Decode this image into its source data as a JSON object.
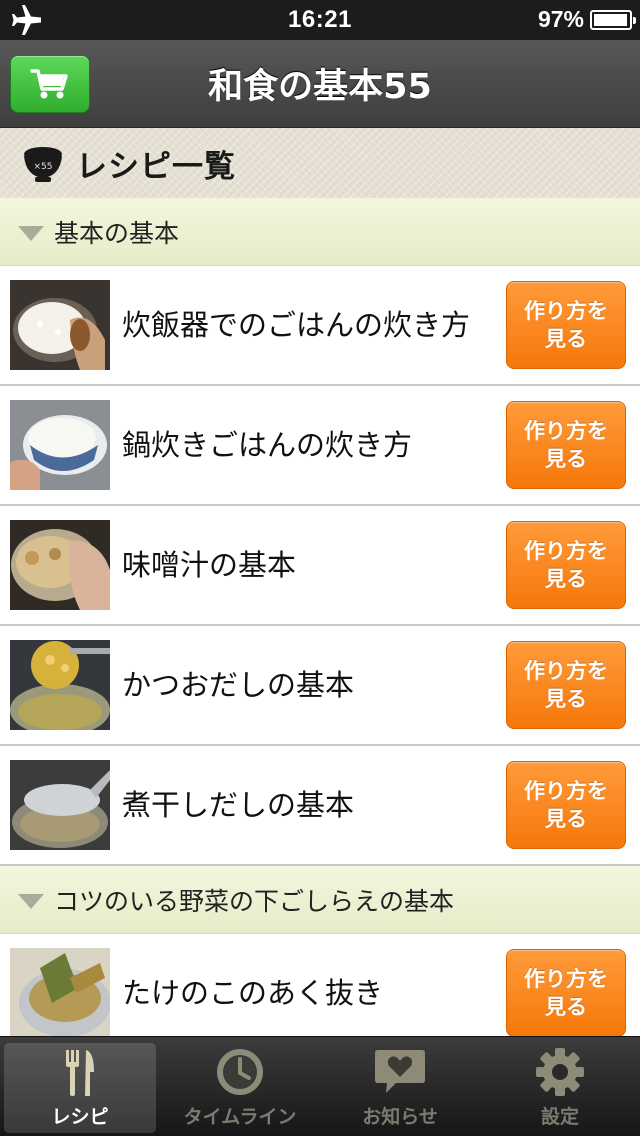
{
  "status_bar": {
    "time": "16:21",
    "battery": "97%"
  },
  "nav": {
    "title": "和食の基本55",
    "cart_icon": "cart-icon"
  },
  "section_header": {
    "title": "レシピ一覧",
    "icon": "bowl-icon"
  },
  "categories": [
    {
      "label": "基本の基本",
      "items": [
        {
          "name": "炊飯器でのごはんの炊き方",
          "button": "作り方を\n見る"
        },
        {
          "name": "鍋炊きごはんの炊き方",
          "button": "作り方を\n見る"
        },
        {
          "name": "味噌汁の基本",
          "button": "作り方を\n見る"
        },
        {
          "name": "かつおだしの基本",
          "button": "作り方を\n見る"
        },
        {
          "name": "煮干しだしの基本",
          "button": "作り方を\n見る"
        }
      ]
    },
    {
      "label": "コツのいる野菜の下ごしらえの基本",
      "items": [
        {
          "name": "たけのこのあく抜き",
          "button": "作り方を\n見る"
        }
      ]
    }
  ],
  "tabs": [
    {
      "label": "レシピ",
      "icon": "fork-knife-icon",
      "active": true
    },
    {
      "label": "タイムライン",
      "icon": "clock-icon",
      "active": false
    },
    {
      "label": "お知らせ",
      "icon": "heart-message-icon",
      "active": false
    },
    {
      "label": "設定",
      "icon": "gear-icon",
      "active": false
    }
  ],
  "colors": {
    "nav": "#4a4a4a",
    "cart_button": "#3cbf39",
    "howto_button": "#f8821d",
    "category_band": "#eaefd0",
    "tab_bar": "#262626"
  }
}
